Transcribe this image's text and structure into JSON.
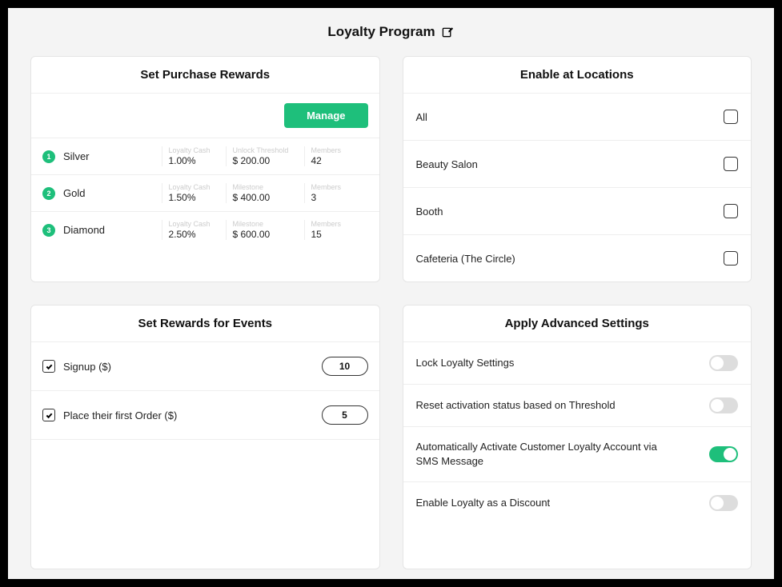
{
  "header": {
    "title": "Loyalty Program"
  },
  "rewards": {
    "title": "Set Purchase Rewards",
    "manage_label": "Manage",
    "columns": {
      "loyalty_cash": "Loyalty Cash",
      "unlock_threshold": "Unlock Threshold",
      "milestone": "Milestone",
      "members": "Members"
    },
    "tiers": [
      {
        "num": "1",
        "name": "Silver",
        "cash": "1.00%",
        "milestone_label": "Unlock Threshold",
        "milestone": "$ 200.00",
        "members": "42"
      },
      {
        "num": "2",
        "name": "Gold",
        "cash": "1.50%",
        "milestone_label": "Milestone",
        "milestone": "$ 400.00",
        "members": "3"
      },
      {
        "num": "3",
        "name": "Diamond",
        "cash": "2.50%",
        "milestone_label": "Milestone",
        "milestone": "$ 600.00",
        "members": "15"
      }
    ]
  },
  "locations": {
    "title": "Enable at Locations",
    "items": [
      {
        "label": "All",
        "checked": false
      },
      {
        "label": "Beauty Salon",
        "checked": false
      },
      {
        "label": "Booth",
        "checked": false
      },
      {
        "label": "Cafeteria (The Circle)",
        "checked": false
      }
    ]
  },
  "events": {
    "title": "Set Rewards for Events",
    "items": [
      {
        "label": "Signup ($)",
        "checked": true,
        "value": "10"
      },
      {
        "label": "Place their first Order ($)",
        "checked": true,
        "value": "5"
      }
    ]
  },
  "advanced": {
    "title": "Apply Advanced Settings",
    "items": [
      {
        "label": "Lock Loyalty Settings",
        "on": false
      },
      {
        "label": "Reset activation status based on Threshold",
        "on": false
      },
      {
        "label": "Automatically Activate Customer Loyalty Account via SMS Message",
        "on": true
      },
      {
        "label": "Enable Loyalty as a Discount",
        "on": false
      }
    ]
  }
}
